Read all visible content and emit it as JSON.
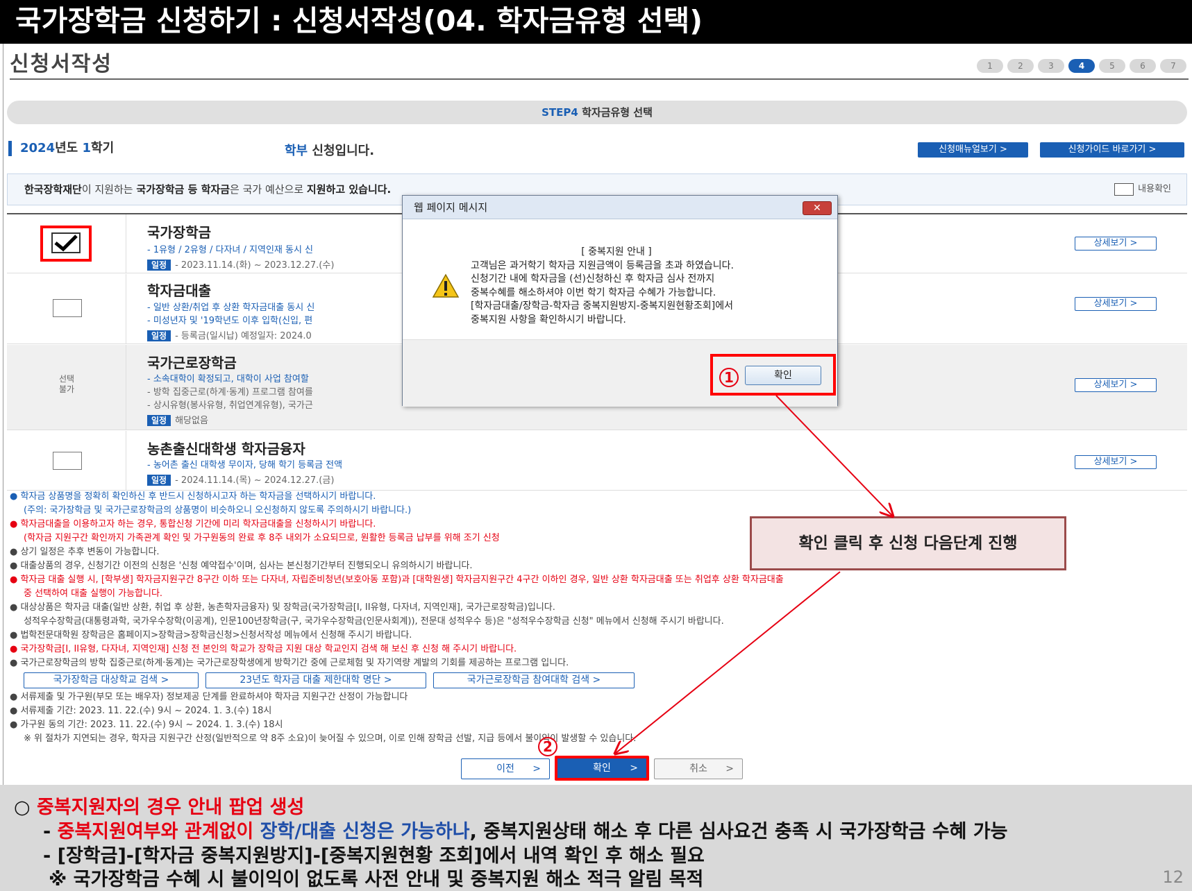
{
  "banner": {
    "title": "국가장학금 신청하기 : 신청서작성(04. 학자금유형 선택)"
  },
  "page": {
    "title": "신청서작성"
  },
  "steps": [
    "1",
    "2",
    "3",
    "4",
    "5",
    "6",
    "7"
  ],
  "active_step": "4",
  "step_bar": {
    "label": "STEP4",
    "text": "학자금유형 선택"
  },
  "semester": {
    "year": "2024",
    "year_unit": "년도 ",
    "term": "1",
    "term_unit": "학기"
  },
  "applicant": {
    "type": "학부",
    "suffix": " 신청입니다."
  },
  "top_buttons": {
    "manual": "신청매뉴얼보기 >",
    "guide": "신청가이드 바로가기 >"
  },
  "notice": {
    "p1": "한국장학재단",
    "p2": "이 지원하는 ",
    "p3": "국가장학금 등 학자금",
    "p4": "은 국가 예산으로 ",
    "p5": "지원하고 있습니다.",
    "confirm_label": "내용확인"
  },
  "products": [
    {
      "name": "국가장학금",
      "line1": "- 1유형 / 2유형 / 다자녀 / 지역인재 동시 신",
      "schedule_tag": "일정",
      "schedule": "- 2023.11.14.(화) ~ 2023.12.27.(수)",
      "detail": "상세보기 >",
      "checked": true
    },
    {
      "name": "학자금대출",
      "line1": "- 일반 상환/취업 후 상환 학자금대출 동시 신",
      "line2": "- 미성년자 및 '19학년도 이후 입학(신입, 편",
      "schedule_tag": "일정",
      "schedule": "- 등록금(일시납) 예정일자: 2024.0",
      "detail": "상세보기 >",
      "checked": false
    },
    {
      "name": "국가근로장학금",
      "line1": "- 소속대학이 확정되고, 대학이 사업 참여할",
      "line2": "- 방학 집중근로(하계·동계) 프로그램 참여를",
      "line3": "- 상시유형(봉사유형, 취업연계유형), 국가근",
      "schedule_tag": "일정",
      "schedule": "해당없음",
      "not_selectable": "선택\n불가",
      "detail": "상세보기 >"
    },
    {
      "name": "농촌출신대학생 학자금융자",
      "line1": "- 농어촌 출신 대학생 무이자, 당해 학기 등록금 전액",
      "schedule_tag": "일정",
      "schedule": "- 2024.11.14.(목) ~ 2024.12.27.(금)",
      "detail": "상세보기 >",
      "checked": false
    }
  ],
  "notes": [
    "● 학자금 상품명을 정확히 확인하신 후 반드시 신청하시고자 하는 학자금을 선택하시기 바랍니다.",
    "(주의: 국가장학금 및 국가근로장학금의 상품명이 비슷하오니 오신청하지 않도록 주의하시기 바랍니다.)",
    "● 학자금대출을 이용하고자 하는 경우, 통합신청 기간에 미리 학자금대출을 신청하시기 바랍니다.",
    "(학자금 지원구간 확인까지 가족관계 확인 및 가구원동의 완료 후 8주 내외가 소요되므로, 원활한 등록금 납부를 위해 조기 신청",
    "● 상기 일정은 추후 변동이 가능합니다.",
    "● 대출상품의 경우, 신청기간 이전의 신청은 '신청 예약접수'이며, 심사는 본신청기간부터 진행되오니 유의하시기 바랍니다.",
    "● 학자금 대출 실행 시, [학부생] 학자금지원구간 8구간 이하 또는 다자녀, 자립준비청년(보호아동 포함)과 [대학원생] 학자금지원구간 4구간 이하인 경우, 일반 상환 학자금대출 또는 취업후 상환 학자금대출",
    "중 선택하여 대출 실행이 가능합니다.",
    "● 대상상품은 학자금 대출(일반 상환, 취업 후 상환, 농촌학자금융자) 및 장학금(국가장학금[I, II유형, 다자녀, 지역인재], 국가근로장학금)입니다.",
    "성적우수장학금(대통령과학, 국가우수장학(이공계), 인문100년장학금(구, 국가우수장학금(인문사회계)), 전문대 성적우수 등)은 \"성적우수장학금 신청\" 메뉴에서 신청해 주시기 바랍니다.",
    "● 법학전문대학원 장학금은 홈페이지>장학금>장학금신청>신청서작성 메뉴에서 신청해 주시기 바랍니다.",
    "● 국가장학금[I, II유형, 다자녀, 지역인재] 신청 전 본인의 학교가 장학금 지원 대상 학교인지 검색 해 보신 후 신청 해 주시기 바랍니다.",
    "● 국가근로장학금의 방학 집중근로(하계·동계)는 국가근로장학생에게 방학기간 중에 근로체험 및 자기역량 계발의 기회를 제공하는 프로그램 입니다.",
    "● 서류제출 및 가구원(부모 또는 배우자) 정보제공 단계를 완료하셔야 학자금 지원구간 산정이 가능합니다",
    "● 서류제출 기간: 2023. 11. 22.(수) 9시 ~ 2024. 1. 3.(수) 18시",
    "● 가구원 동의 기간: 2023. 11. 22.(수) 9시 ~ 2024. 1. 3.(수) 18시",
    "※ 위 절차가 지연되는 경우, 학자금 지원구간 산정(일반적으로 약 8주 소요)이 늦어질 수 있으며, 이로 인해 장학금 선발, 지급 등에서 불이익이 발생할 수 있습니다."
  ],
  "link_buttons": [
    "국가장학금 대상학교 검색 >",
    "23년도 학자금 대출 제한대학 명단 >",
    "국가근로장학금 참여대학 검색 >"
  ],
  "nav": {
    "prev": "이전",
    "confirm": "확인",
    "cancel": "취소",
    "arrow": ">"
  },
  "dialog": {
    "title": "웹 페이지 메시지",
    "close": "✕",
    "heading": "[ 중복지원 안내 ]",
    "lines": [
      "고객님은 과거학기 학자금 지원금액이 등록금을 초과 하였습니다.",
      "신청기간 내에 학자금을 (선)신청하신 후 학자금 심사 전까지",
      "중복수혜를 해소하셔야 이번 학기 학자금 수혜가 가능합니다.",
      "[학자금대출/장학금-학자금 중복지원방지-중복지원현황조회]에서",
      "중복지원 사항을 확인하시기 바랍니다."
    ],
    "ok": "확인"
  },
  "badges": {
    "one": "1",
    "two": "2"
  },
  "callout": "확인 클릭 후 신청 다음단계 진행",
  "bottom": {
    "l1_bullet": "○ ",
    "l1_red": "중복지원자의 경우 안내 팝업 생성",
    "l2_dash": "- ",
    "l2_red": "중복지원여부와 관계없이 ",
    "l2_blue": "장학/대출 신청은 가능하나",
    "l2_rest": ", 중복지원상태 해소 후 다른 심사요건 충족 시 국가장학금 수혜 가능",
    "l3": "- [장학금]-[학자금 중복지원방지]-[중복지원현황 조회]에서 내역 확인 후 해소 필요",
    "l4": "※ 국가장학금 수혜 시 불이익이 없도록 사전 안내 및 중복지원 해소 적극 알림 목적",
    "page_number": "12"
  },
  "colors": {
    "accent": "#1a5fb4",
    "alert": "#e60012",
    "banner": "#000000"
  }
}
